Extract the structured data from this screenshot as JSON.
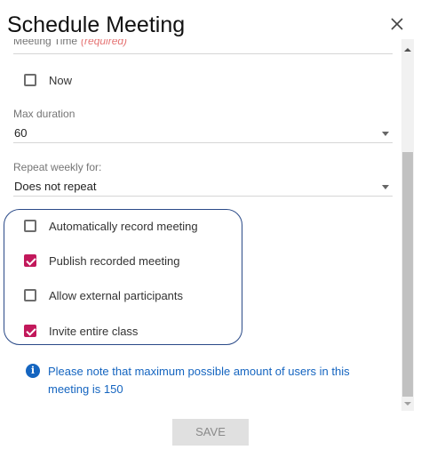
{
  "dialog": {
    "title": "Schedule Meeting"
  },
  "form": {
    "meeting_time": {
      "label": "Meeting Time",
      "required_label": "(required)"
    },
    "now": {
      "label": "Now",
      "checked": false
    },
    "max_duration": {
      "label": "Max duration",
      "value": "60"
    },
    "repeat": {
      "label": "Repeat weekly for:",
      "value": "Does not repeat"
    },
    "options": [
      {
        "label": "Automatically record meeting",
        "checked": false
      },
      {
        "label": "Publish recorded meeting",
        "checked": true
      },
      {
        "label": "Allow external participants",
        "checked": false
      },
      {
        "label": "Invite entire class",
        "checked": true
      }
    ],
    "info_text": "Please note that maximum possible amount of users in this meeting is 150"
  },
  "actions": {
    "save_label": "SAVE"
  },
  "colors": {
    "accent": "#c2185b",
    "info": "#1565c0",
    "highlight_border": "#2a4a88"
  }
}
